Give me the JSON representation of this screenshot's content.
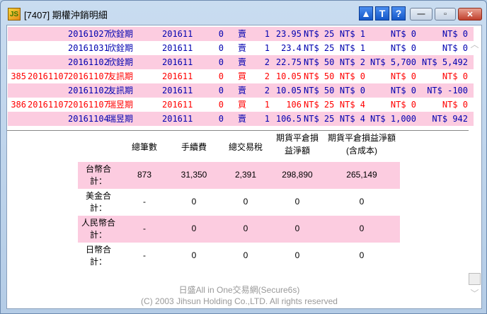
{
  "window": {
    "title": "[7407] 期權沖銷明細",
    "icon_text": "JS",
    "buttons": [
      "▲",
      "T",
      "?"
    ]
  },
  "rows": [
    {
      "no": "",
      "odate": "",
      "date": "20161027",
      "name": "欣銓期",
      "month": "201611",
      "strike": "0",
      "side": "賣",
      "qty": "1",
      "price": "23.95",
      "premium": "NT$ 25",
      "fee": "NT$ 1",
      "tax": "NT$ 0",
      "net": "NT$ 0",
      "color": "blue"
    },
    {
      "no": "",
      "odate": "",
      "date": "20161031",
      "name": "欣銓期",
      "month": "201611",
      "strike": "0",
      "side": "賣",
      "qty": "1",
      "price": "23.4",
      "premium": "NT$ 25",
      "fee": "NT$ 1",
      "tax": "NT$ 0",
      "net": "NT$ 0",
      "color": "blue"
    },
    {
      "no": "",
      "odate": "",
      "date": "20161102",
      "name": "欣銓期",
      "month": "201611",
      "strike": "0",
      "side": "賣",
      "qty": "2",
      "price": "22.75",
      "premium": "NT$ 50",
      "fee": "NT$ 2",
      "tax": "NT$ 5,700",
      "net": "NT$ 5,492",
      "color": "blue"
    },
    {
      "no": "385",
      "odate": "20161107",
      "date": "20161107",
      "name": "友訊期",
      "month": "201611",
      "strike": "0",
      "side": "買",
      "qty": "2",
      "price": "10.05",
      "premium": "NT$ 50",
      "fee": "NT$ 0",
      "tax": "NT$ 0",
      "net": "NT$ 0",
      "color": "red"
    },
    {
      "no": "",
      "odate": "",
      "date": "20161102",
      "name": "友訊期",
      "month": "201611",
      "strike": "0",
      "side": "賣",
      "qty": "2",
      "price": "10.05",
      "premium": "NT$ 50",
      "fee": "NT$ 0",
      "tax": "NT$ 0",
      "net": "NT$ -100",
      "color": "blue"
    },
    {
      "no": "386",
      "odate": "20161107",
      "date": "20161107",
      "name": "瑞昱期",
      "month": "201611",
      "strike": "0",
      "side": "買",
      "qty": "1",
      "price": "106",
      "premium": "NT$ 25",
      "fee": "NT$ 4",
      "tax": "NT$ 0",
      "net": "NT$ 0",
      "color": "red"
    },
    {
      "no": "",
      "odate": "",
      "date": "20161104",
      "name": "瑞昱期",
      "month": "201611",
      "strike": "0",
      "side": "賣",
      "qty": "1",
      "price": "106.5",
      "premium": "NT$ 25",
      "fee": "NT$ 4",
      "tax": "NT$ 1,000",
      "net": "NT$ 942",
      "color": "blue"
    }
  ],
  "summary": {
    "headers": [
      "總筆數",
      "手續費",
      "總交易稅",
      "期貨平倉損\n益淨額",
      "期貨平倉損益淨額\n(含成本)"
    ],
    "rows": [
      {
        "label": "台幣合\n計：",
        "values": [
          "873",
          "31,350",
          "2,391",
          "298,890",
          "265,149"
        ]
      },
      {
        "label": "美金合\n計：",
        "values": [
          "-",
          "0",
          "0",
          "0",
          "0"
        ]
      },
      {
        "label": "人民幣合\n計：",
        "values": [
          "-",
          "0",
          "0",
          "0",
          "0"
        ]
      },
      {
        "label": "日幣合\n計：",
        "values": [
          "-",
          "0",
          "0",
          "0",
          "0"
        ]
      }
    ]
  },
  "footer": {
    "line1": "日盛All in One交易網(Secure6s)",
    "line2": "(C) 2003 Jihsun Holding Co.,LTD. All rights reserved"
  }
}
